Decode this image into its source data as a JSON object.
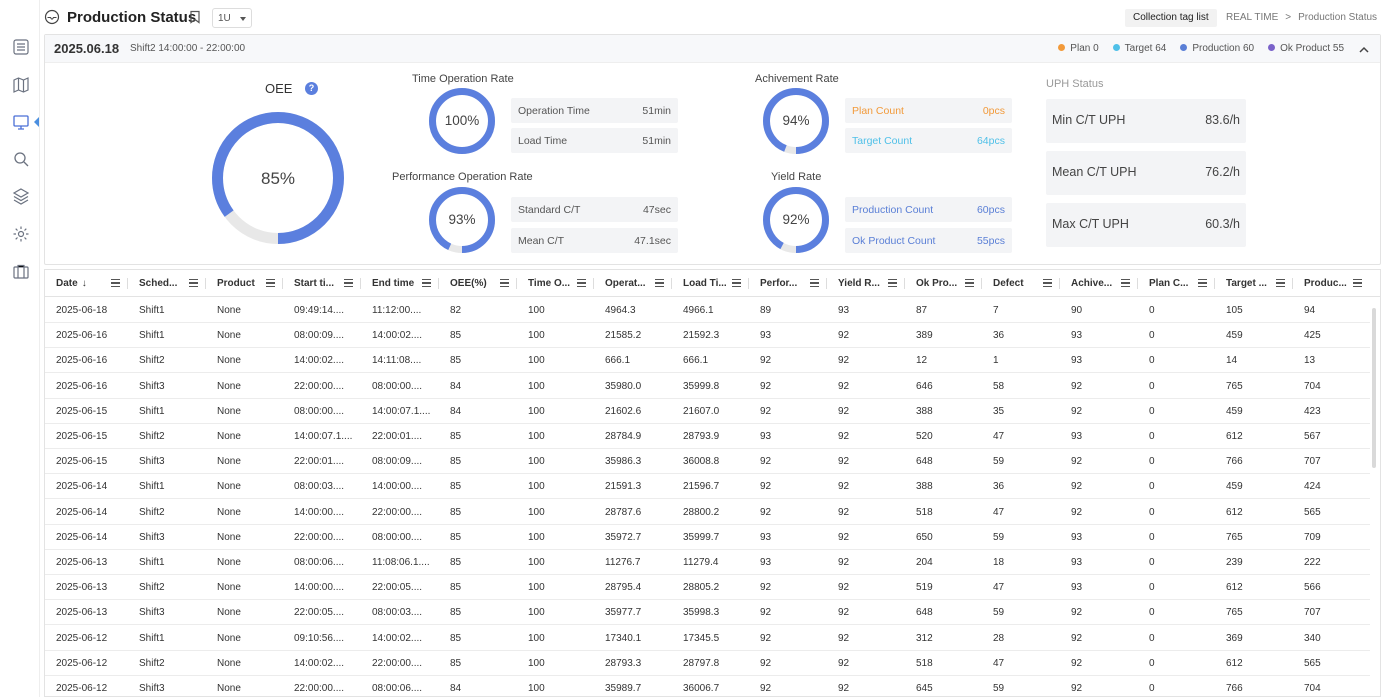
{
  "header": {
    "title": "Production Status",
    "unit_select": "1U",
    "collection_tag_list": "Collection tag list",
    "breadcrumb": [
      "REAL TIME",
      "Production Status"
    ],
    "breadcrumb_sep": ">"
  },
  "summary": {
    "date": "2025.06.18",
    "shift": "Shift2  14:00:00 - 22:00:00",
    "legend": [
      {
        "label": "Plan  0",
        "color": "#f29a3a"
      },
      {
        "label": "Target  64",
        "color": "#4fc0e8"
      },
      {
        "label": "Production  60",
        "color": "#5a7fd6"
      },
      {
        "label": "Ok Product  55",
        "color": "#7a62c9"
      }
    ],
    "oee": {
      "label": "OEE",
      "help": "?",
      "value_text": "85%",
      "fraction": 0.85
    },
    "time_operation": {
      "title": "Time Operation Rate",
      "value_text": "100%",
      "fraction": 1.0,
      "rows": [
        {
          "label": "Operation Time",
          "value": "51min"
        },
        {
          "label": "Load Time",
          "value": "51min"
        }
      ]
    },
    "performance_operation": {
      "title": "Performance Operation Rate",
      "value_text": "93%",
      "fraction": 0.93,
      "rows": [
        {
          "label": "Standard C/T",
          "value": "47sec"
        },
        {
          "label": "Mean C/T",
          "value": "47.1sec"
        }
      ]
    },
    "achievement": {
      "title": "Achivement Rate",
      "value_text": "94%",
      "fraction": 0.94,
      "rows": [
        {
          "label": "Plan Count",
          "value": "0pcs"
        },
        {
          "label": "Target Count",
          "value": "64pcs"
        }
      ]
    },
    "yield": {
      "title": "Yield Rate",
      "value_text": "92%",
      "fraction": 0.92,
      "rows": [
        {
          "label": "Production Count",
          "value": "60pcs"
        },
        {
          "label": "Ok Product Count",
          "value": "55pcs"
        }
      ]
    },
    "uph": {
      "title": "UPH Status",
      "rows": [
        {
          "label": "Min C/T UPH",
          "value": "83.6/h"
        },
        {
          "label": "Mean C/T UPH",
          "value": "76.2/h"
        },
        {
          "label": "Max C/T UPH",
          "value": "60.3/h"
        }
      ]
    },
    "colors": {
      "ring": "#5b7fde",
      "ring_track": "#e8e8e8"
    }
  },
  "table": {
    "sort_arrow": "↓",
    "columns": [
      "Date",
      "Sched...",
      "Product",
      "Start ti...",
      "End time",
      "OEE(%)",
      "Time O...",
      "Operat...",
      "Load Ti...",
      "Perfor...",
      "Yield R...",
      "Ok Pro...",
      "Defect",
      "Achive...",
      "Plan C...",
      "Target ...",
      "Produc..."
    ],
    "rows": [
      [
        "2025-06-18",
        "Shift1",
        "None",
        "09:49:14....",
        "11:12:00....",
        "82",
        "100",
        "4964.3",
        "4966.1",
        "89",
        "93",
        "87",
        "7",
        "90",
        "0",
        "105",
        "94"
      ],
      [
        "2025-06-16",
        "Shift1",
        "None",
        "08:00:09....",
        "14:00:02....",
        "85",
        "100",
        "21585.2",
        "21592.3",
        "93",
        "92",
        "389",
        "36",
        "93",
        "0",
        "459",
        "425"
      ],
      [
        "2025-06-16",
        "Shift2",
        "None",
        "14:00:02....",
        "14:11:08....",
        "85",
        "100",
        "666.1",
        "666.1",
        "92",
        "92",
        "12",
        "1",
        "93",
        "0",
        "14",
        "13"
      ],
      [
        "2025-06-16",
        "Shift3",
        "None",
        "22:00:00....",
        "08:00:00....",
        "84",
        "100",
        "35980.0",
        "35999.8",
        "92",
        "92",
        "646",
        "58",
        "92",
        "0",
        "765",
        "704"
      ],
      [
        "2025-06-15",
        "Shift1",
        "None",
        "08:00:00....",
        "14:00:07.1....",
        "84",
        "100",
        "21602.6",
        "21607.0",
        "92",
        "92",
        "388",
        "35",
        "92",
        "0",
        "459",
        "423"
      ],
      [
        "2025-06-15",
        "Shift2",
        "None",
        "14:00:07.1....",
        "22:00:01....",
        "85",
        "100",
        "28784.9",
        "28793.9",
        "93",
        "92",
        "520",
        "47",
        "93",
        "0",
        "612",
        "567"
      ],
      [
        "2025-06-15",
        "Shift3",
        "None",
        "22:00:01....",
        "08:00:09....",
        "85",
        "100",
        "35986.3",
        "36008.8",
        "92",
        "92",
        "648",
        "59",
        "92",
        "0",
        "766",
        "707"
      ],
      [
        "2025-06-14",
        "Shift1",
        "None",
        "08:00:03....",
        "14:00:00....",
        "85",
        "100",
        "21591.3",
        "21596.7",
        "92",
        "92",
        "388",
        "36",
        "92",
        "0",
        "459",
        "424"
      ],
      [
        "2025-06-14",
        "Shift2",
        "None",
        "14:00:00....",
        "22:00:00....",
        "85",
        "100",
        "28787.6",
        "28800.2",
        "92",
        "92",
        "518",
        "47",
        "92",
        "0",
        "612",
        "565"
      ],
      [
        "2025-06-14",
        "Shift3",
        "None",
        "22:00:00....",
        "08:00:00....",
        "85",
        "100",
        "35972.7",
        "35999.7",
        "93",
        "92",
        "650",
        "59",
        "93",
        "0",
        "765",
        "709"
      ],
      [
        "2025-06-13",
        "Shift1",
        "None",
        "08:00:06....",
        "11:08:06.1....",
        "85",
        "100",
        "11276.7",
        "11279.4",
        "93",
        "92",
        "204",
        "18",
        "93",
        "0",
        "239",
        "222"
      ],
      [
        "2025-06-13",
        "Shift2",
        "None",
        "14:00:00....",
        "22:00:05....",
        "85",
        "100",
        "28795.4",
        "28805.2",
        "92",
        "92",
        "519",
        "47",
        "93",
        "0",
        "612",
        "566"
      ],
      [
        "2025-06-13",
        "Shift3",
        "None",
        "22:00:05....",
        "08:00:03....",
        "85",
        "100",
        "35977.7",
        "35998.3",
        "92",
        "92",
        "648",
        "59",
        "92",
        "0",
        "765",
        "707"
      ],
      [
        "2025-06-12",
        "Shift1",
        "None",
        "09:10:56....",
        "14:00:02....",
        "85",
        "100",
        "17340.1",
        "17345.5",
        "92",
        "92",
        "312",
        "28",
        "92",
        "0",
        "369",
        "340"
      ],
      [
        "2025-06-12",
        "Shift2",
        "None",
        "14:00:02....",
        "22:00:00....",
        "85",
        "100",
        "28793.3",
        "28797.8",
        "92",
        "92",
        "518",
        "47",
        "92",
        "0",
        "612",
        "565"
      ],
      [
        "2025-06-12",
        "Shift3",
        "None",
        "22:00:00....",
        "08:00:06....",
        "84",
        "100",
        "35989.7",
        "36006.7",
        "92",
        "92",
        "645",
        "59",
        "92",
        "0",
        "766",
        "704"
      ]
    ]
  },
  "sidebar": {
    "items": [
      "menu-icon",
      "map-icon",
      "monitor-icon",
      "search-icon",
      "layers-icon",
      "gear-icon",
      "box-icon"
    ]
  }
}
